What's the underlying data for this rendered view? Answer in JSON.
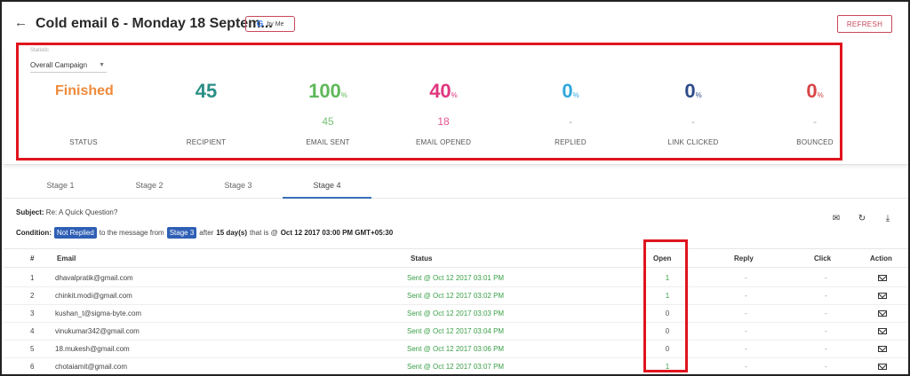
{
  "header": {
    "title": "Cold email 6 - Monday 18 Septem...",
    "google_badge": "by Me",
    "google_letter": "G",
    "refresh_label": "REFRESH"
  },
  "stats": {
    "small_label": "Statistic",
    "select_value": "Overall Campaign",
    "items": [
      {
        "value": "Finished",
        "pct": "",
        "sub": "",
        "label": "STATUS",
        "color": "#f08a3a"
      },
      {
        "value": "45",
        "pct": "",
        "sub": "",
        "label": "RECIPIENT",
        "color": "#2a8f87"
      },
      {
        "value": "100",
        "pct": "%",
        "sub": "45",
        "label": "EMAIL SENT",
        "color": "#5fb85a"
      },
      {
        "value": "40",
        "pct": "%",
        "sub": "18",
        "label": "EMAIL OPENED",
        "color": "#e0357e"
      },
      {
        "value": "0",
        "pct": "%",
        "sub": "-",
        "label": "REPLIED",
        "color": "#2ea8dd"
      },
      {
        "value": "0",
        "pct": "%",
        "sub": "-",
        "label": "LINK CLICKED",
        "color": "#2d4a8a"
      },
      {
        "value": "0",
        "pct": "%",
        "sub": "-",
        "label": "BOUNCED",
        "color": "#d64545"
      }
    ]
  },
  "tabs": [
    "Stage 1",
    "Stage 2",
    "Stage 3",
    "Stage 4"
  ],
  "active_tab": "Stage 4",
  "subject": {
    "label": "Subject:",
    "value": "Re: A Quick Question?"
  },
  "condition": {
    "label": "Condition:",
    "chip1": "Not Replied",
    "text1": "to the message from",
    "chip2": "Stage 3",
    "text2": "after",
    "days": "15 day(s)",
    "text3": "that is @",
    "date": "Oct 12 2017 03:00 PM GMT+05:30"
  },
  "table": {
    "headers": [
      "#",
      "Email",
      "Status",
      "Open",
      "Reply",
      "Click",
      "Action"
    ],
    "rows": [
      {
        "num": "1",
        "email": "dhavalpratik@gmail.com",
        "status": "Sent @ Oct 12 2017 03:01 PM",
        "open": "1",
        "reply": "-",
        "click": "-"
      },
      {
        "num": "2",
        "email": "chinkit.modi@gmail.com",
        "status": "Sent @ Oct 12 2017 03:02 PM",
        "open": "1",
        "reply": "-",
        "click": "-"
      },
      {
        "num": "3",
        "email": "kushan_t@sigma-byte.com",
        "status": "Sent @ Oct 12 2017 03:03 PM",
        "open": "0",
        "reply": "-",
        "click": "-"
      },
      {
        "num": "4",
        "email": "vinukumar342@gmail.com",
        "status": "Sent @ Oct 12 2017 03:04 PM",
        "open": "0",
        "reply": "-",
        "click": "-"
      },
      {
        "num": "5",
        "email": "18.mukesh@gmail.com",
        "status": "Sent @ Oct 12 2017 03:06 PM",
        "open": "0",
        "reply": "-",
        "click": "-"
      },
      {
        "num": "6",
        "email": "chotaiamit@gmail.com",
        "status": "Sent @ Oct 12 2017 03:07 PM",
        "open": "1",
        "reply": "-",
        "click": "-"
      }
    ]
  }
}
